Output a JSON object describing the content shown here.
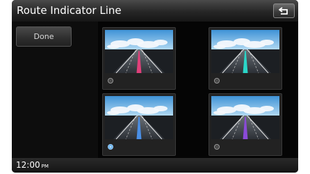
{
  "header": {
    "title": "Route Indicator Line",
    "back_icon": "back-arrow-icon"
  },
  "sidebar": {
    "done_label": "Done"
  },
  "options": [
    {
      "line_color": "#e0407a",
      "selected": false
    },
    {
      "line_color": "#2bd6c8",
      "selected": false
    },
    {
      "line_color": "#4a8fe6",
      "selected": true
    },
    {
      "line_color": "#8a4ad8",
      "selected": false
    }
  ],
  "status": {
    "time": "12:00",
    "ampm": "PM"
  },
  "colors": {
    "background": "#050505",
    "sky": "#6bb4e8",
    "road": "#3a3f45",
    "selected_radio": "#5aa8e8"
  }
}
